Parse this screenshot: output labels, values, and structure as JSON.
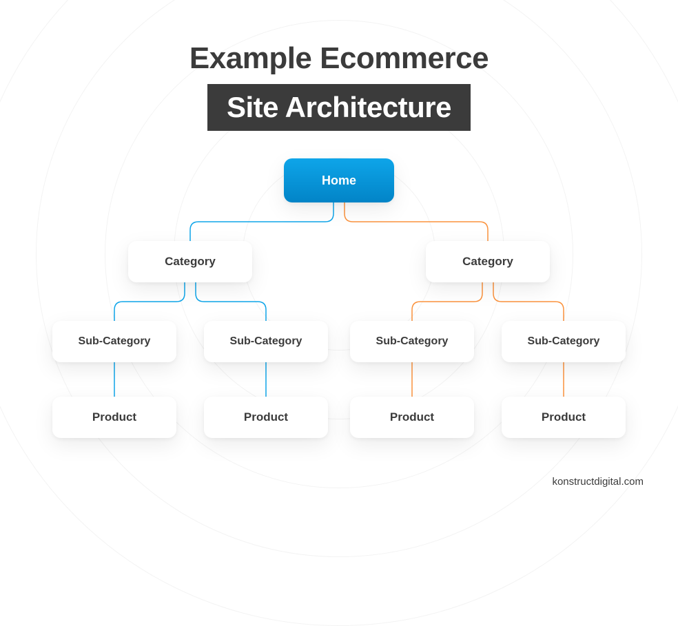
{
  "title": {
    "line1": "Example Ecommerce",
    "line2": "Site Architecture"
  },
  "tree": {
    "root": "Home",
    "left": {
      "category": "Category",
      "sub1": "Sub-Category",
      "sub2": "Sub-Category",
      "prod1": "Product",
      "prod2": "Product"
    },
    "right": {
      "category": "Category",
      "sub1": "Sub-Category",
      "sub2": "Sub-Category",
      "prod1": "Product",
      "prod2": "Product"
    }
  },
  "colors": {
    "blue": "#0ea5e9",
    "orange": "#fb923c",
    "dark": "#3b3b3b"
  },
  "attribution": "konstructdigital.com"
}
